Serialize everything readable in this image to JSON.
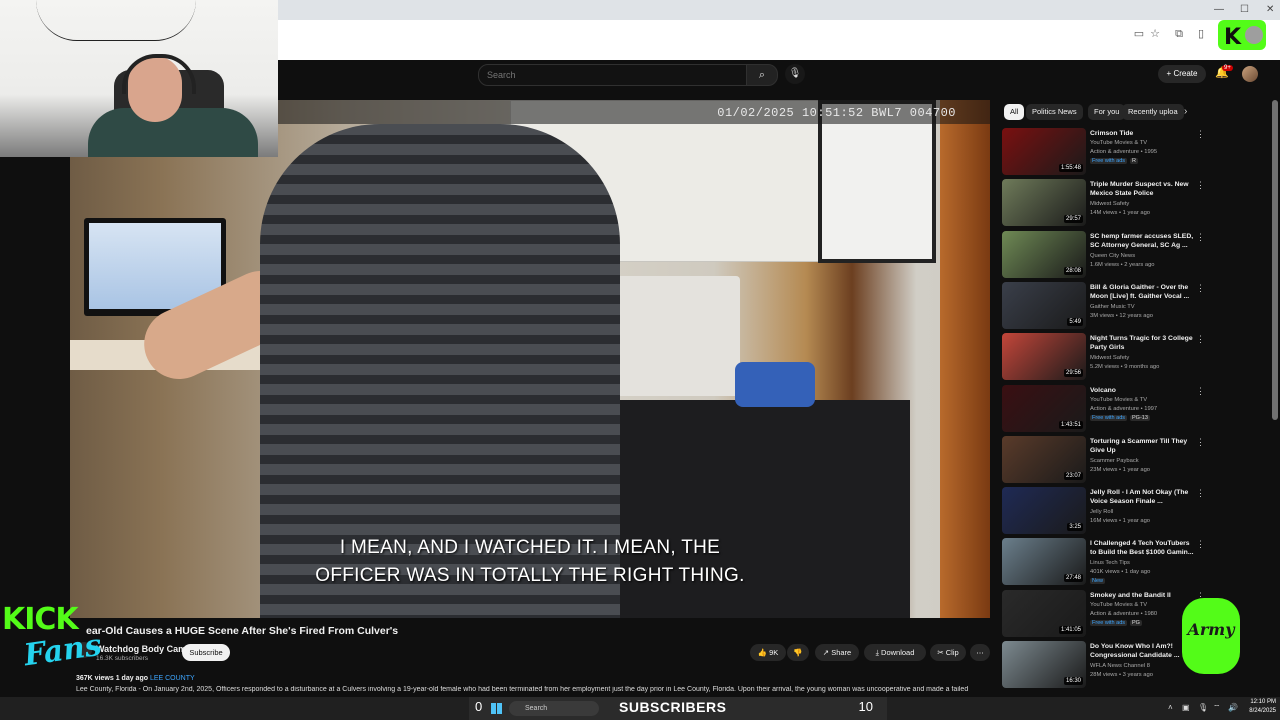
{
  "browser": {
    "win_min": "—",
    "win_max": "☐",
    "win_close": "✕"
  },
  "header": {
    "search_placeholder": "Search",
    "create_label": "Create",
    "notif_count": "9+"
  },
  "video": {
    "overlay_timestamp": "01/02/2025 10:51:52   BWL7 004700",
    "caption_line1": "I MEAN, AND I WATCHED IT. I MEAN, THE",
    "caption_line2": "OFFICER WAS IN TOTALLY THE RIGHT THING.",
    "title": "ear-Old Causes a HUGE Scene After She's Fired From Culver's",
    "channel_name": "Watchdog Body Cam",
    "channel_subs": "16.3K subscribers",
    "subscribe_label": "Subscribe",
    "like_count": "9K",
    "share_label": "Share",
    "download_label": "Download",
    "clip_label": "Clip",
    "views": "367K views",
    "age": "1 day ago",
    "tag": "LEE COUNTY",
    "description": "Lee County, Florida - On January 2nd, 2025, Officers responded to a disturbance at a Culvers involving a 19-year-old female who had been terminated from her employment just the day prior in Lee County, Florida. Upon their arrival, the young woman was uncooperative and made a failed"
  },
  "chips": [
    "All",
    "Politics News",
    "For you",
    "Recently uploa"
  ],
  "recommendations": [
    {
      "title": "Crimson Tide",
      "channel": "YouTube Movies & TV",
      "meta": "Action & adventure • 1995",
      "badge1": "Free with ads",
      "badge2": "R",
      "duration": "1:55:48",
      "color": "#7a1010"
    },
    {
      "title": "Triple Murder Suspect vs. New Mexico State Police",
      "channel": "Midwest Safety",
      "meta": "14M views • 1 year ago",
      "badge1": "",
      "badge2": "",
      "duration": "29:57",
      "color": "#6f7b5a"
    },
    {
      "title": "SC hemp farmer accuses SLED, SC Attorney General, SC Ag ...",
      "channel": "Queen City News",
      "meta": "1.6M views • 2 years ago",
      "badge1": "",
      "badge2": "",
      "duration": "28:08",
      "color": "#6f8a55"
    },
    {
      "title": "Bill & Gloria Gaither - Over the Moon [Live] ft. Gaither Vocal ...",
      "channel": "Gaither Music TV",
      "meta": "3M views • 12 years ago",
      "badge1": "",
      "badge2": "",
      "duration": "5:49",
      "color": "#3a3f4a"
    },
    {
      "title": "Night Turns Tragic for 3 College Party Girls",
      "channel": "Midwest Safety",
      "meta": "5.2M views • 9 months ago",
      "badge1": "",
      "badge2": "",
      "duration": "29:56",
      "color": "#c3463a"
    },
    {
      "title": "Volcano",
      "channel": "YouTube Movies & TV",
      "meta": "Action & adventure • 1997",
      "badge1": "Free with ads",
      "badge2": "PG-13",
      "duration": "1:43:51",
      "color": "#3a0f12"
    },
    {
      "title": "Torturing a Scammer Till They Give Up",
      "channel": "Scammer Payback",
      "meta": "23M views • 1 year ago",
      "badge1": "",
      "badge2": "",
      "duration": "23:07",
      "color": "#5a3b2a"
    },
    {
      "title": "Jelly Roll - I Am Not Okay (The Voice Season Finale ...",
      "channel": "Jelly Roll",
      "meta": "16M views • 1 year ago",
      "badge1": "",
      "badge2": "",
      "duration": "3:25",
      "color": "#1f2a55"
    },
    {
      "title": "I Challenged 4 Tech YouTubers to Build the Best $1000 Gamin...",
      "channel": "Linus Tech Tips",
      "meta": "401K views • 1 day ago",
      "badge1": "New",
      "badge2": "",
      "duration": "27:48",
      "color": "#6b7f8c"
    },
    {
      "title": "Smokey and the Bandit II",
      "channel": "YouTube Movies & TV",
      "meta": "Action & adventure • 1980",
      "badge1": "Free with ads",
      "badge2": "PG",
      "duration": "1:41:05",
      "color": "#2a2a2a"
    },
    {
      "title": "Do You Know Who I Am?! Congressional Candidate ...",
      "channel": "WFLA News Channel 8",
      "meta": "28M views • 3 years ago",
      "badge1": "",
      "badge2": "",
      "duration": "16:30",
      "color": "#7d8a90"
    }
  ],
  "overlays": {
    "kick_text": "KICK",
    "fans_text": "Fans",
    "army_text": "Army"
  },
  "taskbar": {
    "sub_count_left": "0",
    "search_label": "Search",
    "subscribers_label": "SUBSCRIBERS",
    "sub_count_right": "10",
    "time": "12:10 PM",
    "date": "8/24/2025"
  }
}
